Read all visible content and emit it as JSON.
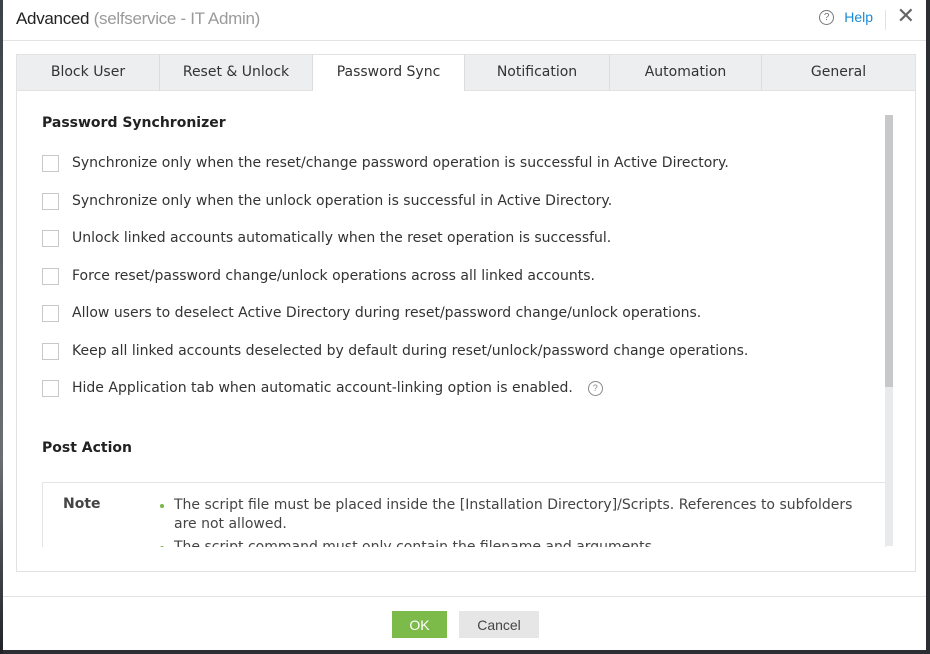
{
  "dialog": {
    "title": "Advanced",
    "subtitle": "(selfservice - IT Admin)",
    "help_label": "Help",
    "help_icon": "question-circle-icon",
    "close_icon": "close-icon"
  },
  "tabs": [
    {
      "label": "Block User",
      "active": false
    },
    {
      "label": "Reset & Unlock",
      "active": false
    },
    {
      "label": "Password Sync",
      "active": true
    },
    {
      "label": "Notification",
      "active": false
    },
    {
      "label": "Automation",
      "active": false
    },
    {
      "label": "General",
      "active": false
    }
  ],
  "password_synchronizer": {
    "title": "Password Synchronizer",
    "options": [
      {
        "label": "Synchronize only when the reset/change password operation is successful in Active Directory.",
        "checked": false
      },
      {
        "label": "Synchronize only when the unlock operation is successful in Active Directory.",
        "checked": false
      },
      {
        "label": "Unlock linked accounts automatically when the reset operation is successful.",
        "checked": false
      },
      {
        "label": "Force reset/password change/unlock operations across all linked accounts.",
        "checked": false
      },
      {
        "label": "Allow users to deselect Active Directory during reset/password change/unlock operations.",
        "checked": false
      },
      {
        "label": "Keep all linked accounts deselected by default during reset/unlock/password change operations.",
        "checked": false
      },
      {
        "label": "Hide Application tab when automatic account-linking option is enabled.",
        "checked": false,
        "has_help_icon": true
      }
    ]
  },
  "post_action": {
    "title": "Post Action",
    "note_label": "Note",
    "notes": [
      "The script file must be placed inside the [Installation Directory]/Scripts. References to subfolders are not allowed.",
      "The script command must only contain the filename and arguments."
    ]
  },
  "scroll": {
    "position_fraction": 0.0,
    "visible_fraction": 0.63
  },
  "footer": {
    "ok_label": "OK",
    "cancel_label": "Cancel"
  },
  "colors": {
    "accent_link": "#1a8bd6",
    "ok_button": "#7cba4a",
    "bullet": "#7ab648"
  }
}
